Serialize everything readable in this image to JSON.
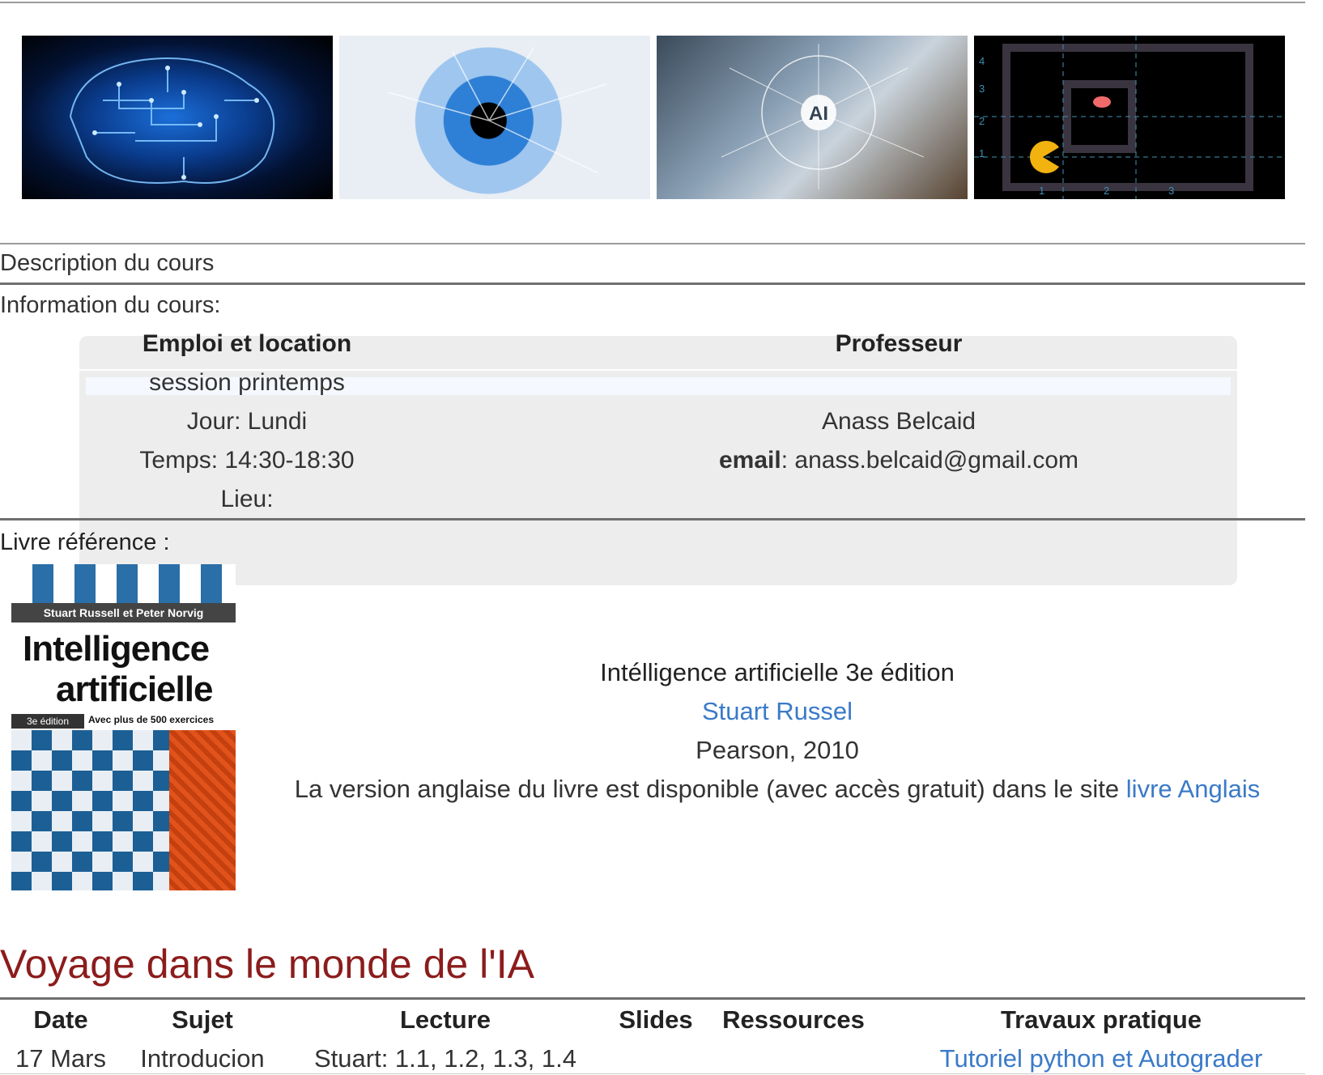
{
  "banner_images": [
    {
      "icon": "circuit-brain-image"
    },
    {
      "icon": "eye-image"
    },
    {
      "icon": "ai-network-image",
      "text": "AI"
    },
    {
      "icon": "pacman-grid-image",
      "row_labels": [
        "4",
        "3",
        "2",
        "1"
      ],
      "col_labels": [
        "1",
        "2",
        "3"
      ]
    }
  ],
  "sections": {
    "description": "Description du cours",
    "information": "Information du cours:",
    "book_reference": "Livre référence :"
  },
  "info_table": {
    "headers": [
      "Emploi et location",
      "Professeur"
    ],
    "session": "session printemps",
    "day": "Jour: Lundi",
    "time": "Temps: 14:30-18:30",
    "place": "Lieu:",
    "professor_name": "Anass Belcaid",
    "email_label": "email",
    "email_value": ": anass.belcaid@gmail.com"
  },
  "book": {
    "cover": {
      "authors": "Stuart Russell et Peter Norvig",
      "title_line1": "Intelligence",
      "title_line2": "artificielle",
      "edition": "3e édition",
      "exercises": "Avec plus de 500 exercices"
    },
    "title": "Intélligence artificielle 3e édition",
    "author_link": "Stuart Russel",
    "publisher": "Pearson, 2010",
    "english_note": "La version anglaise du livre est disponible (avec accès gratuit) dans le site",
    "english_link": "livre Anglais"
  },
  "schedule": {
    "title": "Voyage dans le monde de l'IA",
    "columns": [
      "Date",
      "Sujet",
      "Lecture",
      "Slides",
      "Ressources",
      "Travaux pratique"
    ],
    "rows": [
      {
        "date": "17 Mars",
        "subject": "Introducion",
        "lecture": "Stuart: 1.1, 1.2, 1.3, 1.4",
        "slides": "",
        "resources": "",
        "practical": "Tutoriel python et Autograder"
      }
    ]
  },
  "colors": {
    "link": "#3a7ac8",
    "section_title": "#8c1c1c"
  }
}
